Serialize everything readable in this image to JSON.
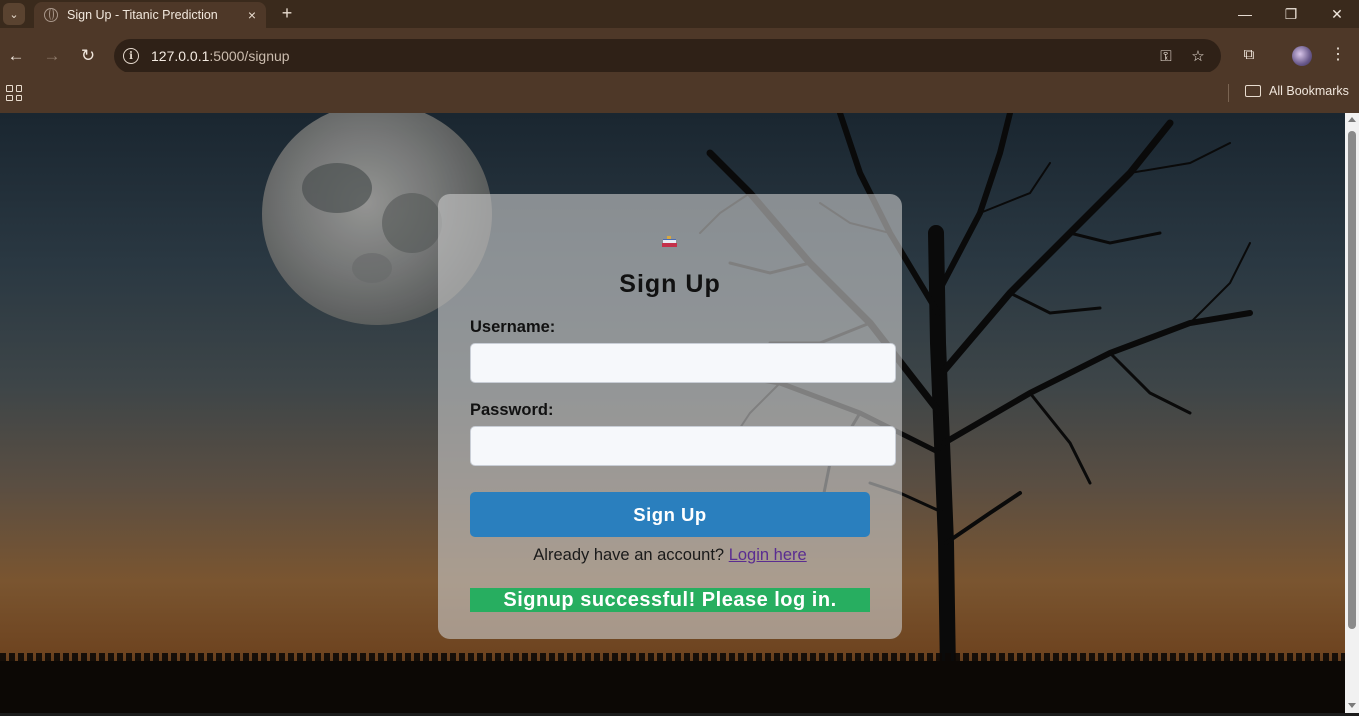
{
  "browser": {
    "tab_title": "Sign Up - Titanic Prediction",
    "tab_close": "×",
    "new_tab": "+",
    "url_host": "127.0.0.1",
    "url_path": ":5000/signup",
    "bookmarks_label": "All Bookmarks",
    "minimize": "—",
    "restore": "❐",
    "close": "✕"
  },
  "page": {
    "title": "Sign Up",
    "username_label": "Username:",
    "username_value": "",
    "password_label": "Password:",
    "password_value": "",
    "submit_label": "Sign Up",
    "login_prompt": "Already have an account?",
    "login_link": "Login here",
    "flash_message": "Signup successful! Please log in."
  },
  "colors": {
    "button": "#2a7fbe",
    "flash": "#27ae60",
    "link": "#5a2d91"
  }
}
